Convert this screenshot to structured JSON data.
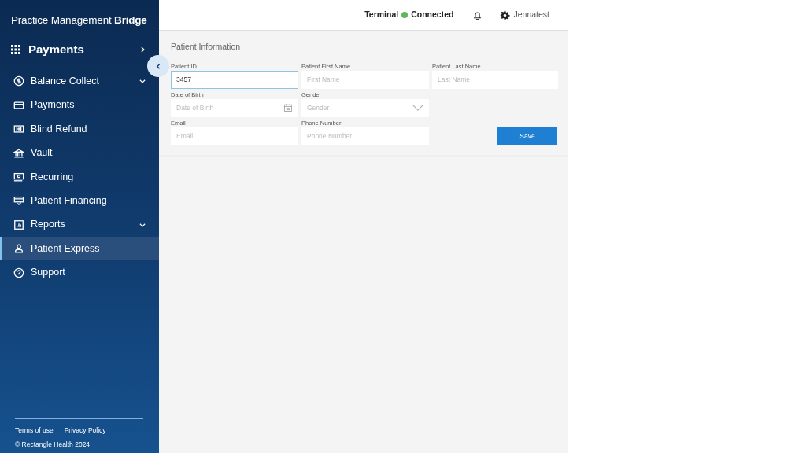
{
  "sidebar": {
    "logo": "Practice Management **Bridge**",
    "section": {
      "title": "Payments"
    },
    "items": [
      {
        "label": "Balance Collect",
        "has_submenu": true,
        "selected": false
      },
      {
        "label": "Payments",
        "has_submenu": false,
        "selected": false
      },
      {
        "label": "Blind Refund",
        "has_submenu": false,
        "selected": false
      },
      {
        "label": "Vault",
        "has_submenu": false,
        "selected": false
      },
      {
        "label": "Recurring",
        "has_submenu": false,
        "selected": false
      },
      {
        "label": "Patient Financing",
        "has_submenu": false,
        "selected": false
      },
      {
        "label": "Reports",
        "has_submenu": true,
        "selected": false
      },
      {
        "label": "Patient Express",
        "has_submenu": false,
        "selected": true
      },
      {
        "label": "Support",
        "has_submenu": false,
        "selected": false
      }
    ],
    "footer_links": [
      "Terms of use",
      "Privacy Policy"
    ],
    "copyright": "© Rectangle Health 2024"
  },
  "header": {
    "terminal": {
      "label": "Terminal",
      "status": "Connected",
      "color": "#5cb85c"
    },
    "user": "Jennatest"
  },
  "form": {
    "title": "Patient Information",
    "fields": [
      {
        "label": "Patient ID",
        "kind": "text",
        "value": "3457",
        "focused": true
      },
      {
        "label": "Patient First Name",
        "kind": "text",
        "placeholder": "First Name",
        "focused": false
      },
      {
        "label": "Patient Last Name",
        "kind": "text",
        "placeholder": "Last Name",
        "focused": false
      },
      {
        "label": "Date of Birth",
        "kind": "date",
        "placeholder": "Date of Birth",
        "focused": false
      },
      {
        "label": "Gender",
        "kind": "select",
        "placeholder": "Gender",
        "focused": false
      },
      {
        "label": "Email",
        "kind": "text",
        "placeholder": "Email",
        "focused": false
      },
      {
        "label": "Phone Number",
        "kind": "text",
        "placeholder": "Phone Number",
        "focused": false
      }
    ],
    "save_button": "Save"
  }
}
